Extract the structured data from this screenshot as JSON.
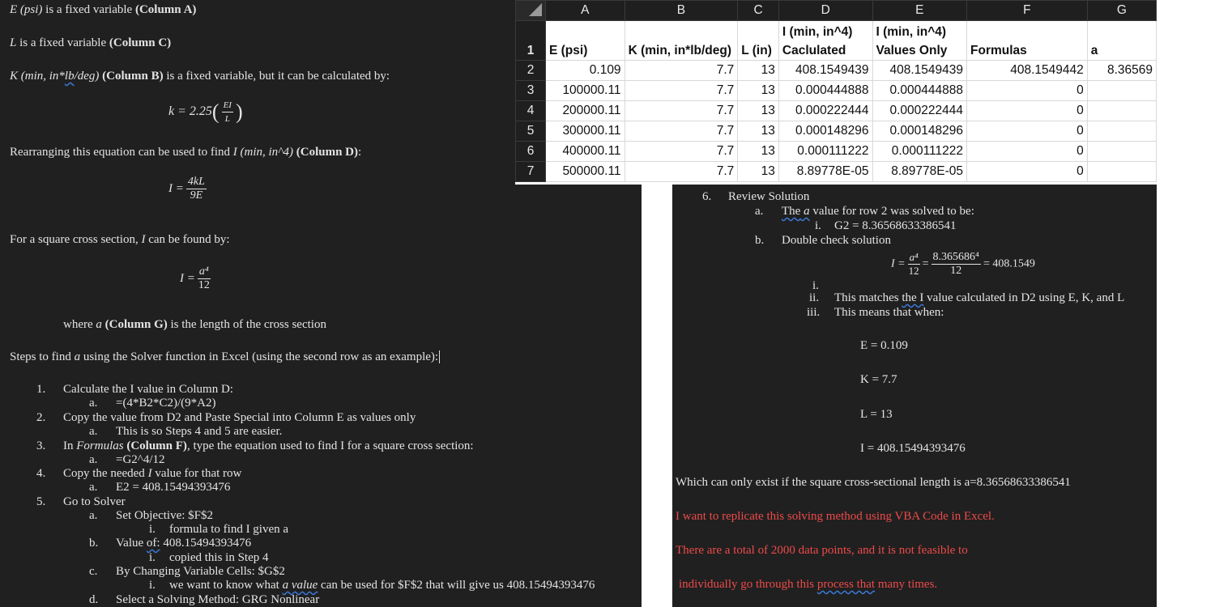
{
  "left": {
    "l1": {
      "it": "E (psi)",
      "t": " is a fixed variable ",
      "b": "(Column A)"
    },
    "l2": {
      "it": "L",
      "t": " is a fixed variable ",
      "b": "(Column C)"
    },
    "l3": {
      "it1": "K (min, in*",
      "sq": "lb",
      "it2": "/deg)",
      "b": " (Column B)",
      "t": " is a fixed variable, but it can be calculated by:"
    },
    "eq_k": {
      "lhs": "k = 2.25",
      "num": "EI",
      "den": "L"
    },
    "l4": {
      "t1": "Rearranging this equation can be used to find ",
      "it": "I (min, in^4)",
      "b": " (Column D)",
      "t2": ":"
    },
    "eq_i": {
      "lhs": "I =",
      "num": "4kL",
      "den": "9E"
    },
    "l5": {
      "t1": "For a square cross section, ",
      "it": "I",
      "t2": " can be found by:"
    },
    "eq_sq": {
      "lhs": "I =",
      "num": "a⁴",
      "den": "12"
    },
    "l6": {
      "t1": "where ",
      "it": "a",
      "b": " (Column G)",
      "t2": " is the length of the cross section"
    },
    "l7": {
      "t1": "Steps to find ",
      "it": "a",
      "t2": " using the Solver function in Excel (using the second row as an example):"
    },
    "steps": {
      "s1": {
        "n": "1.",
        "t": "Calculate the I value in Column D:"
      },
      "s1a": {
        "n": "a.",
        "t": "=(4*B2*C2)/(9*A2)"
      },
      "s2": {
        "n": "2.",
        "t": "Copy the value from D2 and Paste Special into Column E as values only"
      },
      "s2a": {
        "n": "a.",
        "t": "This is so Steps 4 and 5 are easier."
      },
      "s3": {
        "n": "3.",
        "t1": "In ",
        "it": "Formulas",
        "b": " (Column F)",
        "t2": ", type the equation used to find I for a square cross section:"
      },
      "s3a": {
        "n": "a.",
        "t": "=G2^4/12"
      },
      "s4": {
        "n": "4.",
        "t1": "Copy the needed ",
        "it": "I",
        "t2": " value for that row"
      },
      "s4a": {
        "n": "a.",
        "t": "E2 = 408.15494393476"
      },
      "s5": {
        "n": "5.",
        "t": "Go to Solver"
      },
      "s5a": {
        "n": "a.",
        "t": "Set Objective: $F$2"
      },
      "s5ai": {
        "n": "i.",
        "t": "formula to find I given a"
      },
      "s5b": {
        "n": "b.",
        "t1": "Value ",
        "sq": "of:",
        "t2": " 408.15494393476"
      },
      "s5bi": {
        "n": "i.",
        "t": "copied this in Step 4"
      },
      "s5c": {
        "n": "c.",
        "t": "By Changing Variable Cells: $G$2"
      },
      "s5ci": {
        "n": "i.",
        "t1": "we want to know what ",
        "sq": "a value",
        "t2": " can be used for $F$2 that will give us 408.15494393476"
      },
      "s5d": {
        "n": "d.",
        "t": "Select a Solving Method: GRG Nonlinear"
      }
    }
  },
  "sheet": {
    "cols": [
      "A",
      "B",
      "C",
      "D",
      "E",
      "F",
      "G"
    ],
    "row_numbers": [
      "1",
      "2",
      "3",
      "4",
      "5",
      "6",
      "7"
    ],
    "headers": [
      "E (psi)",
      "K (min, in*lb/deg)",
      "L (in)",
      "I (min, in^4) Caclulated",
      "I (min, in^4) Values Only",
      "Formulas",
      "a"
    ],
    "rows": [
      [
        "0.109",
        "7.7",
        "13",
        "408.1549439",
        "408.1549439",
        "408.1549442",
        "8.36569"
      ],
      [
        "100000.11",
        "7.7",
        "13",
        "0.000444888",
        "0.000444888",
        "0",
        ""
      ],
      [
        "200000.11",
        "7.7",
        "13",
        "0.000222444",
        "0.000222444",
        "0",
        ""
      ],
      [
        "300000.11",
        "7.7",
        "13",
        "0.000148296",
        "0.000148296",
        "0",
        ""
      ],
      [
        "400000.11",
        "7.7",
        "13",
        "0.000111222",
        "0.000111222",
        "0",
        ""
      ],
      [
        "500000.11",
        "7.7",
        "13",
        "8.89778E-05",
        "8.89778E-05",
        "0",
        ""
      ]
    ]
  },
  "right": {
    "r6": {
      "n": "6.",
      "t": "Review Solution"
    },
    "r6a": {
      "n": "a.",
      "sq": "The",
      "it": " a",
      "t": " value for row 2 was solved to be:"
    },
    "r6ai": {
      "n": "i.",
      "t": "G2 = 8.36568633386541"
    },
    "r6b": {
      "n": "b.",
      "t": "Double check solution"
    },
    "eq": {
      "lhs": "I =",
      "f1n": "a⁴",
      "f1d": "12",
      "eq": "=",
      "f2n": "8.365686⁴",
      "f2d": "12",
      "rhs": "= 408.1549"
    },
    "r6bi": {
      "n": "i."
    },
    "r6bii": {
      "n": "ii.",
      "t1": "This matches ",
      "sq": "the I",
      "t2": " value calculated in D2 using E, K, and L"
    },
    "r6biii": {
      "n": "iii.",
      "t": "This means that when:"
    },
    "e": "E = 0.109",
    "k": "K = 7.7",
    "l": "L = 13",
    "i": "I = 408.15494393476",
    "exist": "Which can only exist if the square cross-sectional length is a=8.36568633386541",
    "red1": "I want to replicate this solving method using VBA Code in Excel.",
    "red2": "There are a total of 2000 data points, and it is not feasible to",
    "red3a": "individually go through this ",
    "red3sq": "process that",
    "red3b": " many times."
  }
}
